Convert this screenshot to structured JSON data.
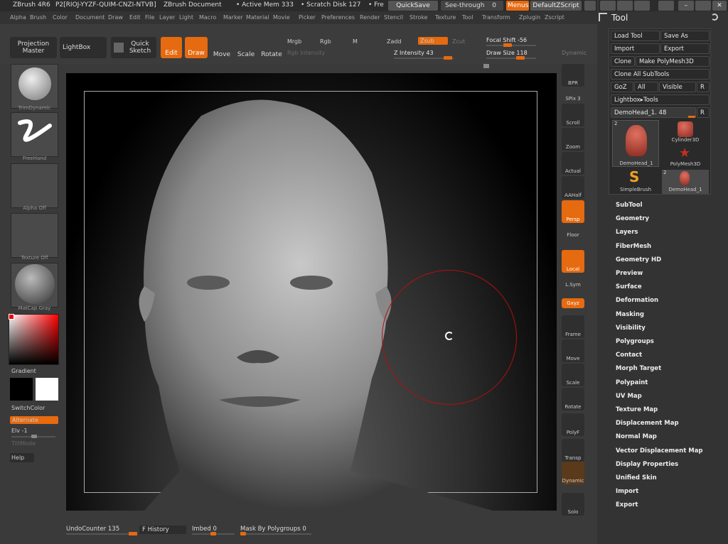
{
  "titlebar": {
    "app": "ZBrush 4R6",
    "key": "P2[RIOJ-YYZF-QUIM-CNZI-NTVB]",
    "doc": "ZBrush Document",
    "mem": "• Active Mem 333",
    "scratch": "• Scratch Disk 127",
    "free": "• Fre",
    "quicksave": "QuickSave",
    "seethrough": "See-through",
    "seethrough_val": "0",
    "menus": "Menus",
    "defaultzscript": "DefaultZScript"
  },
  "menubar": [
    "Alpha",
    "Brush",
    "Color",
    "Document",
    "Draw",
    "Edit",
    "File",
    "Layer",
    "Light",
    "Macro",
    "Marker",
    "Material",
    "Movie",
    "Picker",
    "Preferences",
    "Render",
    "Stencil",
    "Stroke",
    "Texture",
    "Tool",
    "Transform",
    "Zplugin",
    "Zscript"
  ],
  "toolbar": {
    "projection_master": "Projection Master",
    "lightbox": "LightBox",
    "quick_sketch": "Quick Sketch",
    "edit": "Edit",
    "draw": "Draw",
    "move": "Move",
    "scale": "Scale",
    "rotate": "Rotate",
    "mrgb": "Mrgb",
    "rgb": "Rgb",
    "m": "M",
    "rgb_intensity": "Rgb Intensity",
    "zadd": "Zadd",
    "zsub": "Zsub",
    "zcut": "Zcut",
    "z_intensity": "Z Intensity 43",
    "focal_shift": "Focal Shift -56",
    "draw_size": "Draw Size 118",
    "dynamic": "Dynamic"
  },
  "leftpanel": {
    "brush": "TrimDynamic",
    "stroke": "FreeHand",
    "alpha": "Alpha Off",
    "texture": "Texture Off",
    "material": "MatCap Gray",
    "gradient": "Gradient",
    "switchcolor": "SwitchColor",
    "alternate": "Alternate",
    "elv": "Elv -1",
    "tiltmode": "TiltMode",
    "help": "Help"
  },
  "rightbar": [
    "BPR",
    "SPix 3",
    "Scroll",
    "Zoom",
    "Actual",
    "AAHalf",
    "Persp",
    "Floor",
    "Local",
    "L.Sym",
    "Gxyz",
    "Frame",
    "Move",
    "Scale",
    "Rotate",
    "PolyF",
    "Transp",
    "Dynamic",
    "Solo"
  ],
  "toolpanel": {
    "title": "Tool",
    "load_tool": "Load Tool",
    "save_as": "Save As",
    "import": "Import",
    "export": "Export",
    "clone": "Clone",
    "make_polymesh": "Make PolyMesh3D",
    "clone_all": "Clone All SubTools",
    "goz": "GoZ",
    "all": "All",
    "visible": "Visible",
    "r": "R",
    "lightbox_tools": "Lightbox▸Tools",
    "current_tool": "DemoHead_1. 48",
    "tools": [
      "DemoHead_1",
      "Cylinder3D",
      "PolyMesh3D",
      "SimpleBrush",
      "DemoHead_1"
    ],
    "tool_counts": [
      "2",
      "2"
    ],
    "items": [
      "SubTool",
      "Geometry",
      "Layers",
      "FiberMesh",
      "Geometry HD",
      "Preview",
      "Surface",
      "Deformation",
      "Masking",
      "Visibility",
      "Polygroups",
      "Contact",
      "Morph Target",
      "Polypaint",
      "UV Map",
      "Texture Map",
      "Displacement Map",
      "Normal Map",
      "Vector Displacement Map",
      "Display Properties",
      "Unified Skin",
      "Import",
      "Export"
    ]
  },
  "bottombar": {
    "undo": "UndoCounter 135",
    "history": "F History",
    "imbed": "Imbed 0",
    "mask": "Mask By Polygroups 0"
  }
}
